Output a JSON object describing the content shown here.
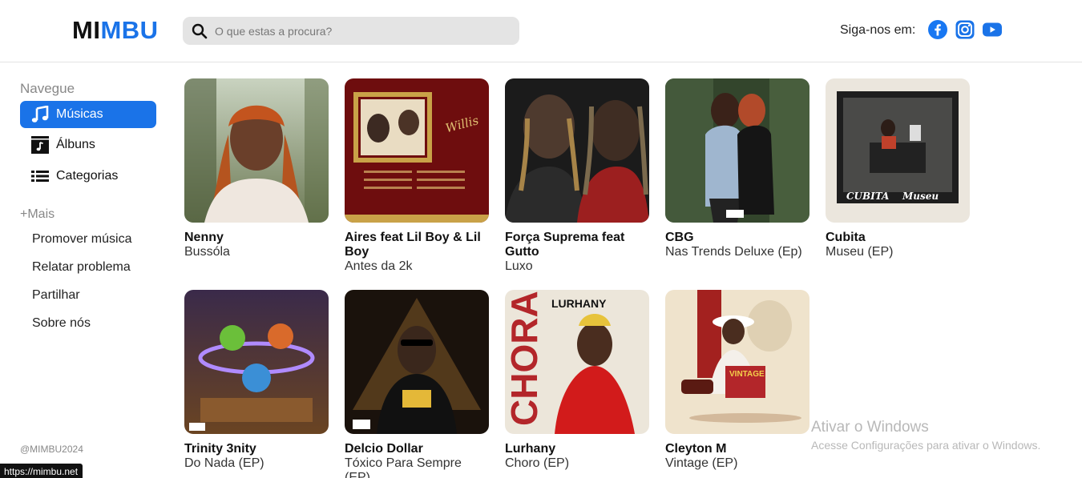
{
  "brand": {
    "logo_part1": "MI",
    "logo_part2": "MBU"
  },
  "search": {
    "placeholder": "O que estas a procura?"
  },
  "header": {
    "follow_label": "Siga-nos em:",
    "social": [
      {
        "icon": "facebook-icon",
        "color": "#1877f2"
      },
      {
        "icon": "instagram-icon",
        "color": "#1a73e8"
      },
      {
        "icon": "youtube-icon",
        "color": "#1a73e8"
      }
    ]
  },
  "sidebar": {
    "nav_title": "Navegue",
    "items": [
      {
        "label": "Músicas",
        "icon": "music-note-icon",
        "active": true
      },
      {
        "label": "Álbuns",
        "icon": "album-icon",
        "active": false
      },
      {
        "label": "Categorias",
        "icon": "list-icon",
        "active": false
      }
    ],
    "more_title": "+Mais",
    "more_links": [
      "Promover música",
      "Relatar problema",
      "Partilhar",
      "Sobre nós"
    ],
    "copyright": "@MIMBU2024"
  },
  "songs": [
    {
      "artist": "Nenny",
      "title": "Bussóla"
    },
    {
      "artist": "Aires feat Lil Boy & Lil Boy",
      "title": "Antes da 2k"
    },
    {
      "artist": "Força Suprema feat Gutto",
      "title": "Luxo"
    },
    {
      "artist": "CBG",
      "title": "Nas Trends Deluxe (Ep)"
    },
    {
      "artist": "Cubita",
      "title": "Museu (EP)"
    },
    {
      "artist": "Trinity 3nity",
      "title": "Do Nada (EP)"
    },
    {
      "artist": "Delcio Dollar",
      "title": "Tóxico Para Sempre (EP)"
    },
    {
      "artist": "Lurhany",
      "title": "Choro (EP)"
    },
    {
      "artist": "Cleyton M",
      "title": "Vintage (EP)"
    }
  ],
  "cover_text": {
    "willis": "Willis",
    "cubita": "CUBITA",
    "museu": "Museu",
    "chora": "CHORA",
    "lurhany": "LURHANY",
    "vintage": "VINTAGE",
    "advisory": "PARENTAL ADVISORY"
  },
  "overlay": {
    "watermark_title": "Ativar o Windows",
    "watermark_sub": "Acesse Configurações para ativar o Windows.",
    "status_url": "https://mimbu.net"
  },
  "colors": {
    "accent": "#1a73e8"
  }
}
